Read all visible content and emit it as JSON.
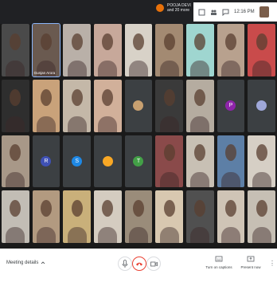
{
  "presenter": {
    "name": "POOJA DEVI",
    "more": "and 20 more"
  },
  "clock": "12:16 PM",
  "spotlight_label": "Gunjan Arora",
  "avatars": [
    {
      "letter": "P",
      "color": "#8e24aa"
    },
    {
      "letter": "R",
      "color": "#3f51b5"
    },
    {
      "letter": "S",
      "color": "#1e88e5"
    },
    {
      "letter": "T",
      "color": "#43a047"
    }
  ],
  "bottom": {
    "meeting_details": "Meeting details",
    "captions_label": "Turn on captions",
    "present_label": "Present now"
  }
}
